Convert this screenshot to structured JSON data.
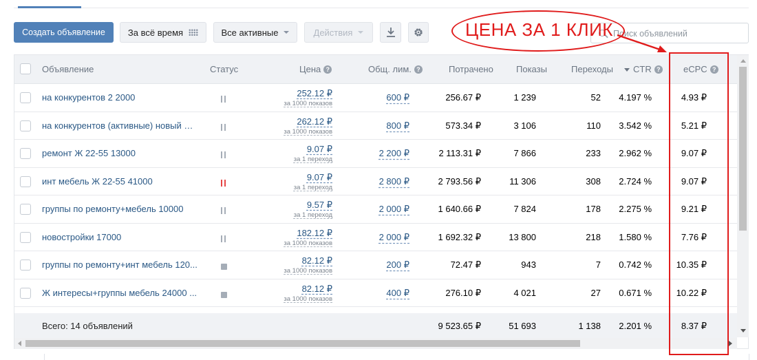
{
  "toolbar": {
    "create_label": "Создать объявление",
    "period_label": "За всё время",
    "filter_label": "Все активные",
    "actions_label": "Действия",
    "search_placeholder": "Поиск объявлений"
  },
  "columns": {
    "ad": "Объявление",
    "status": "Статус",
    "price": "Цена",
    "limit": "Общ. лим.",
    "spent": "Потрачено",
    "shows": "Показы",
    "clicks": "Переходы",
    "ctr": "CTR",
    "ecpc": "eCPC"
  },
  "rows": [
    {
      "name": "на конкурентов 2 2000",
      "status": "paused",
      "price": "252.12 ₽",
      "price_unit": "за 1000 показов",
      "limit": "600 ₽",
      "spent": "256.67 ₽",
      "shows": "1 239",
      "clicks": "52",
      "ctr": "4.197 %",
      "ecpc": "4.93 ₽"
    },
    {
      "name": "на конкурентов (активные) новый м...",
      "status": "paused",
      "price": "262.12 ₽",
      "price_unit": "за 1000 показов",
      "limit": "800 ₽",
      "spent": "573.34 ₽",
      "shows": "3 106",
      "clicks": "110",
      "ctr": "3.542 %",
      "ecpc": "5.21 ₽"
    },
    {
      "name": "ремонт Ж 22-55 13000",
      "status": "paused",
      "price": "9.07 ₽",
      "price_unit": "за 1 переход",
      "limit": "2 200 ₽",
      "spent": "2 113.31 ₽",
      "shows": "7 866",
      "clicks": "233",
      "ctr": "2.962 %",
      "ecpc": "9.07 ₽"
    },
    {
      "name": "инт мебель Ж 22-55 41000",
      "status": "paused-red",
      "price": "9.07 ₽",
      "price_unit": "за 1 переход",
      "limit": "2 800 ₽",
      "spent": "2 793.56 ₽",
      "shows": "11 306",
      "clicks": "308",
      "ctr": "2.724 %",
      "ecpc": "9.07 ₽"
    },
    {
      "name": "группы по ремонту+мебель 10000",
      "status": "paused",
      "price": "9.57 ₽",
      "price_unit": "за 1 переход",
      "limit": "2 000 ₽",
      "spent": "1 640.66 ₽",
      "shows": "7 824",
      "clicks": "178",
      "ctr": "2.275 %",
      "ecpc": "9.21 ₽"
    },
    {
      "name": "новостройки 17000",
      "status": "paused",
      "price": "182.12 ₽",
      "price_unit": "за 1000 показов",
      "limit": "2 000 ₽",
      "spent": "1 692.32 ₽",
      "shows": "13 800",
      "clicks": "218",
      "ctr": "1.580 %",
      "ecpc": "7.76 ₽"
    },
    {
      "name": "группы по ремонту+инт мебель 120...",
      "status": "stopped",
      "price": "82.12 ₽",
      "price_unit": "за 1000 показов",
      "limit": "200 ₽",
      "spent": "72.47 ₽",
      "shows": "943",
      "clicks": "7",
      "ctr": "0.742 %",
      "ecpc": "10.35 ₽"
    },
    {
      "name": "Ж интересы+группы мебель 24000 ...",
      "status": "stopped",
      "price": "82.12 ₽",
      "price_unit": "за 1000 показов",
      "limit": "400 ₽",
      "spent": "276.10 ₽",
      "shows": "4 021",
      "clicks": "27",
      "ctr": "0.671 %",
      "ecpc": "10.22 ₽"
    }
  ],
  "total": {
    "label": "Всего: 14 объявлений",
    "spent": "9 523.65 ₽",
    "shows": "51 693",
    "clicks": "1 138",
    "ctr": "2.201 %",
    "ecpc": "8.37 ₽"
  },
  "annotation": {
    "text": "ЦЕНА ЗА 1 КЛИК",
    "color": "#e01b1b"
  },
  "colors": {
    "accent": "#5181b8",
    "link": "#2a5885",
    "paused_red": "#e64646"
  }
}
